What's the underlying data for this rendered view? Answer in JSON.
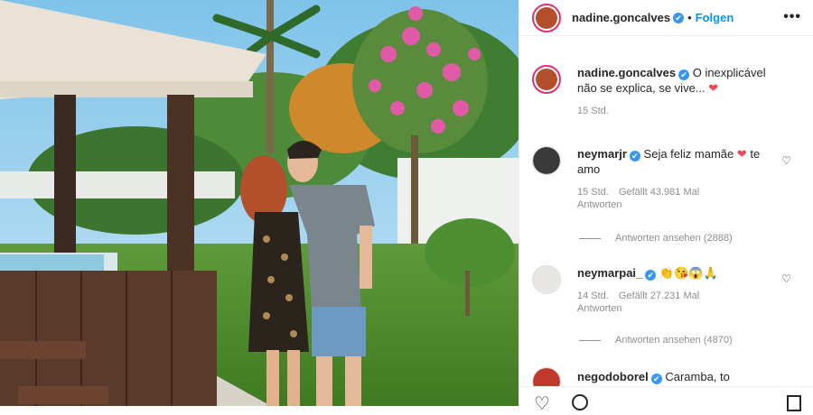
{
  "post_author": {
    "username": "nadine.goncalves",
    "follow_label": "Folgen",
    "separator": "•",
    "more_label": "•••",
    "verified_glyph": "✔"
  },
  "caption": {
    "username": "nadine.goncalves",
    "text": "O inexplicável não se explica, se vive...",
    "emoji": "❤",
    "time": "15 Std."
  },
  "comments": [
    {
      "username": "neymarjr",
      "text": "Seja feliz mamãe",
      "emoji": "❤",
      "text_after": "te amo",
      "time": "15 Std.",
      "likes": "Gefällt 43.981 Mal",
      "reply": "Antworten",
      "view_replies": "Antworten ansehen (2888)"
    },
    {
      "username": "neymarpai_",
      "text": "👏😘😱🙏",
      "time": "14 Std.",
      "likes": "Gefällt 27.231 Mal",
      "reply": "Antworten",
      "view_replies": "Antworten ansehen (4870)"
    },
    {
      "username": "negodoborel",
      "text": "Caramba, to"
    }
  ],
  "icons": {
    "heart": "heart-icon",
    "comment": "comment-icon",
    "bookmark": "bookmark-icon",
    "more": "more-icon"
  },
  "colors": {
    "link_blue": "#0095f6",
    "verified_blue": "#3897f0",
    "heart_red": "#ed4956",
    "meta_gray": "#8e8e8e"
  }
}
